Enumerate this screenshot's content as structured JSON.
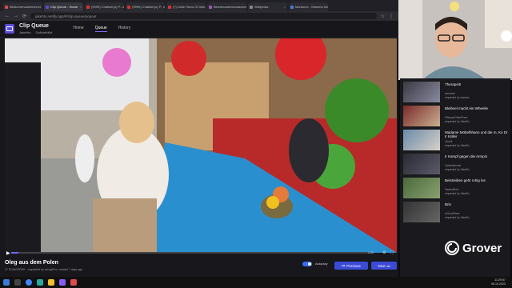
{
  "browser": {
    "tabs": [
      {
        "label": "Bildschirmaufzeichnet",
        "color": "#e04b4b"
      },
      {
        "label": "Clip Queue - Home",
        "color": "#5b4bd6",
        "active": true
      },
      {
        "label": "(9999) Chatster(s) P.. memes",
        "color": "#e03030"
      },
      {
        "label": "(9999) Chatster(s) P.. memes",
        "color": "#e03030"
      },
      {
        "label": "(?) Dolle Show Of Interest!",
        "color": "#e03030"
      },
      {
        "label": "Bluesmaskenmaskenmask",
        "color": "#9b59b6"
      },
      {
        "label": "Wikipedia",
        "color": "#888888"
      },
      {
        "label": "Marianne - Mamma hell and Tuffi",
        "color": "#4a7bd6"
      }
    ],
    "url": "jakehtx.netlify.app/#/clip-queue/popout"
  },
  "app": {
    "title": "Clip Queue",
    "sub_user": "JakeHtx",
    "sub_chat": "GoNorthKid",
    "nav": [
      "Home",
      "Queue",
      "History"
    ],
    "active_nav": "Queue"
  },
  "video": {
    "watermark": "Grover",
    "progress": 0.02,
    "time": "0:03"
  },
  "clip": {
    "title": "Oleg aus dem Polen",
    "meta": "17 EDINGEREK - requested by senegiFrs, created 7 days ago",
    "autoplay_label": "Autoplay",
    "previous_label": "Previous",
    "next_label": "Next"
  },
  "sidebar": {
    "items": [
      {
        "title": "Therapeit!",
        "meta1": "zeendriel",
        "meta2": "requested by sssssss"
      },
      {
        "title": "Bleibsel macht ein Wheelie",
        "meta1": "PitstopInOtherPlace",
        "meta2": "requested by JakeHtx"
      },
      {
        "title": "Madame Möbelhhann und die m, Ko Dr Ir Küller",
        "meta1": "Jinzrdi",
        "meta2": "requested by JakeHtx"
      },
      {
        "title": "Ir Kampf gegen die Armpin",
        "meta1": "Calisbahkunst",
        "meta2": "requested by JakeHtx"
      },
      {
        "title": "Beistreiben geht ruhig los",
        "meta1": "TasshoBhim",
        "meta2": "requested by JakeHtx"
      },
      {
        "title": "Brin",
        "meta1": "InGoodPlace",
        "meta2": "requested by JakeHtx"
      }
    ]
  },
  "taskbar": {
    "time": "11:29:57",
    "date": "08.10.2023"
  }
}
